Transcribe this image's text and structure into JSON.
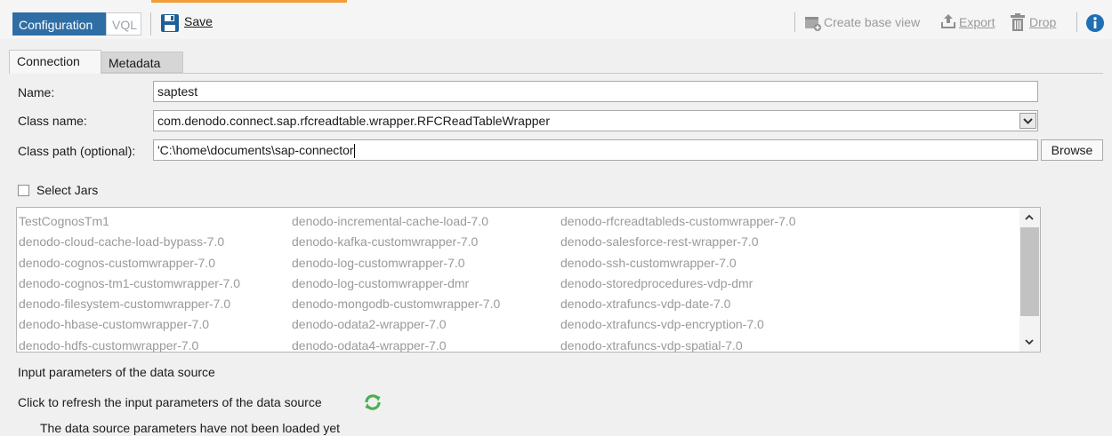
{
  "toolbar": {
    "configuration_label": "Configuration",
    "vql_label": "VQL",
    "save_label": "Save",
    "create_base_view_label": "Create base view",
    "export_label": "Export",
    "drop_label": "Drop",
    "accent_color": "#f29d38",
    "selected_color": "#2f6ea5"
  },
  "tabs": [
    {
      "label": "Connection",
      "selected": true
    },
    {
      "label": "Metadata",
      "selected": false
    }
  ],
  "form": {
    "name_label": "Name:",
    "name_value": "saptest",
    "class_name_label": "Class name:",
    "class_name_value": "com.denodo.connect.sap.rfcreadtable.wrapper.RFCReadTableWrapper",
    "class_path_label": "Class path (optional):",
    "class_path_value": "'C:\\home\\documents\\sap-connector",
    "browse_label": "Browse",
    "select_jars_label": "Select Jars"
  },
  "jars": {
    "col1": [
      "TestCognosTm1",
      "denodo-cloud-cache-load-bypass-7.0",
      "denodo-cognos-customwrapper-7.0",
      "denodo-cognos-tm1-customwrapper-7.0",
      "denodo-filesystem-customwrapper-7.0",
      "denodo-hbase-customwrapper-7.0",
      "denodo-hdfs-customwrapper-7.0"
    ],
    "col2": [
      "denodo-incremental-cache-load-7.0",
      "denodo-kafka-customwrapper-7.0",
      "denodo-log-customwrapper-7.0",
      "denodo-log-customwrapper-dmr",
      "denodo-mongodb-customwrapper-7.0",
      "denodo-odata2-wrapper-7.0",
      "denodo-odata4-wrapper-7.0"
    ],
    "col3": [
      "denodo-rfcreadtableds-customwrapper-7.0",
      "denodo-salesforce-rest-wrapper-7.0",
      "denodo-ssh-customwrapper-7.0",
      "denodo-storedprocedures-vdp-dmr",
      "denodo-xtrafuncs-vdp-date-7.0",
      "denodo-xtrafuncs-vdp-encryption-7.0",
      "denodo-xtrafuncs-vdp-spatial-7.0"
    ]
  },
  "params": {
    "heading": "Input parameters of the data source",
    "refresh_label": "Click to refresh the input parameters of the data source",
    "status": "The data source parameters have not been loaded yet"
  }
}
